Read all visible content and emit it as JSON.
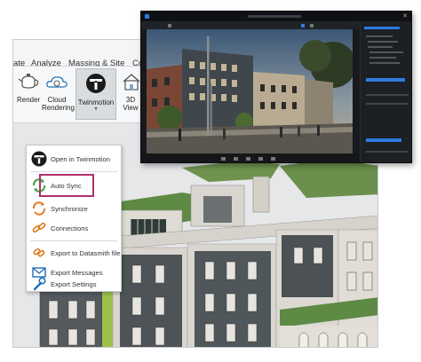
{
  "revit": {
    "tabs": [
      "ate",
      "Analyze",
      "Massing & Site",
      "Collaborate"
    ],
    "ribbon": {
      "render": "Render",
      "cloud_rendering": "Cloud\nRendering",
      "twinmotion": "Twinmotion",
      "view3d": "3D\nView"
    },
    "menu": {
      "items": [
        {
          "label": "Open in Twinmotion",
          "icon": "twinmotion-logo-icon"
        },
        {
          "label": "Auto Sync",
          "icon": "auto-sync-icon",
          "highlighted": true
        },
        {
          "label": "Synchronize",
          "icon": "synchronize-icon"
        },
        {
          "label": "Connections",
          "icon": "connections-icon"
        },
        {
          "label": "Export to Datasmith file",
          "icon": "datasmith-icon"
        },
        {
          "label": "Export Messages",
          "icon": "messages-icon"
        },
        {
          "label": "Export Settings",
          "icon": "settings-wrench-icon"
        }
      ]
    }
  },
  "colors": {
    "highlight": "#b0306a",
    "ribbon_bg": "#f7f8f9",
    "tm_bg": "#17191d",
    "tm_accent": "#2d7be0"
  }
}
